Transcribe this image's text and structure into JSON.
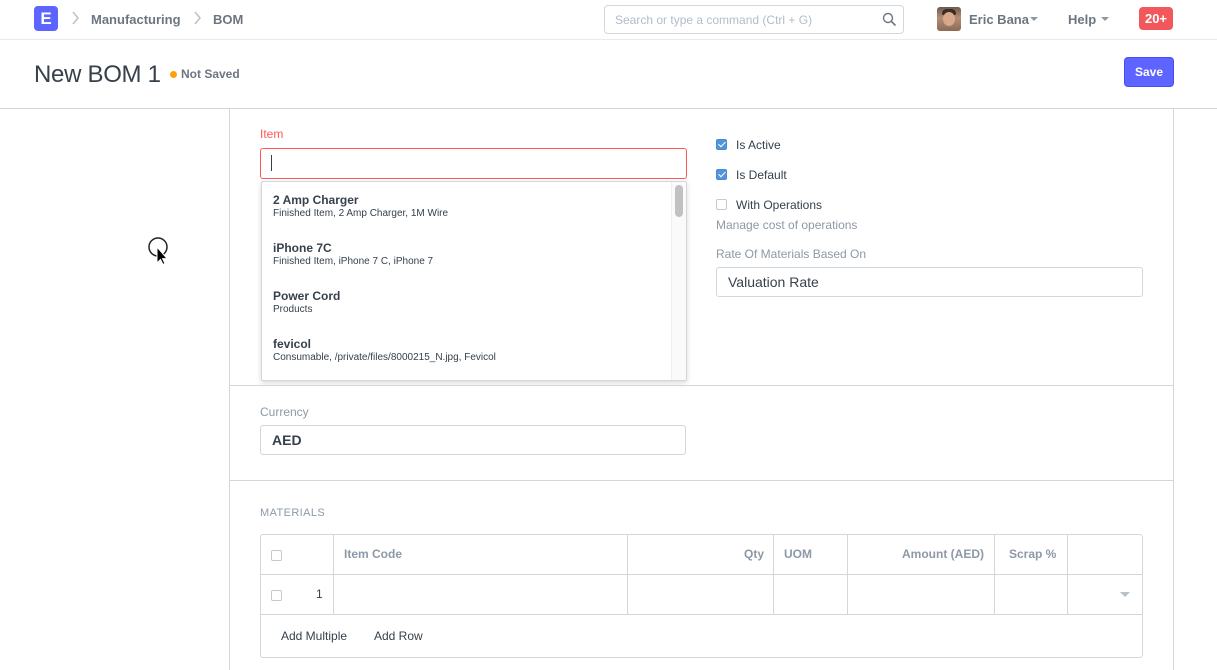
{
  "app": {
    "logo_letter": "E"
  },
  "breadcrumb": [
    "Manufacturing",
    "BOM"
  ],
  "search": {
    "placeholder": "Search or type a command (Ctrl + G)"
  },
  "user": {
    "name": "Eric Bana"
  },
  "help": {
    "label": "Help"
  },
  "notifications": {
    "count": "20+"
  },
  "page": {
    "title": "New BOM 1",
    "status": "Not Saved",
    "save_label": "Save"
  },
  "colors": {
    "primary": "#5e64ff",
    "status_dot": "#ffa00a",
    "error": "#ff5858",
    "notif": "#f2575b",
    "checkbox": "#5295db"
  },
  "form": {
    "item": {
      "label": "Item",
      "value": "",
      "suggestions": [
        {
          "title": "2 Amp Charger",
          "description": "Finished Item, 2 Amp Charger, 1M Wire"
        },
        {
          "title": "iPhone 7C",
          "description": "Finished Item, iPhone 7 C, iPhone 7"
        },
        {
          "title": "Power Cord",
          "description": "Products"
        },
        {
          "title": "fevicol",
          "description": "Consumable, /private/files/8000215_N.jpg, Fevicol"
        }
      ]
    },
    "is_active": {
      "label": "Is Active",
      "checked": true
    },
    "is_default": {
      "label": "Is Default",
      "checked": true
    },
    "with_operations": {
      "label": "With Operations",
      "checked": false,
      "help": "Manage cost of operations"
    },
    "rate_of_materials": {
      "label": "Rate Of Materials Based On",
      "value": "Valuation Rate"
    },
    "currency": {
      "label": "Currency",
      "value": "AED"
    }
  },
  "materials": {
    "title": "MATERIALS",
    "columns": [
      "Item Code",
      "Qty",
      "UOM",
      "Amount (AED)",
      "Scrap %"
    ],
    "rows": [
      {
        "idx": "1",
        "item_code": "",
        "qty": "",
        "uom": "",
        "amount": "",
        "scrap": ""
      }
    ],
    "add_multiple_label": "Add Multiple",
    "add_row_label": "Add Row"
  }
}
